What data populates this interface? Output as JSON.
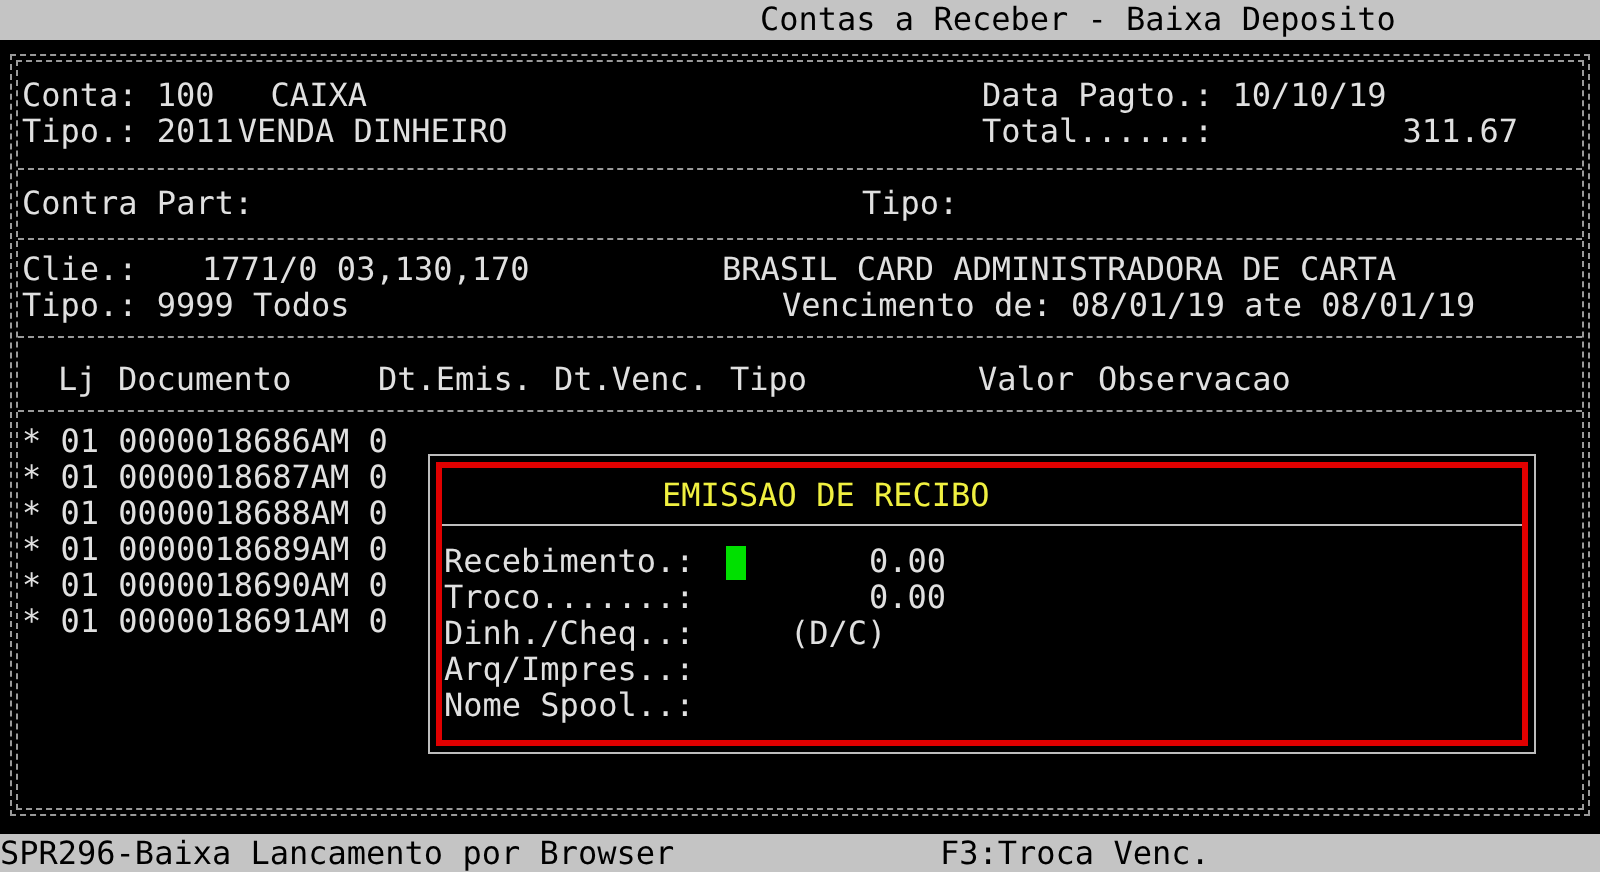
{
  "window": {
    "title": "Contas a Receber - Baixa Deposito"
  },
  "account": {
    "conta_label": "Conta:",
    "conta": "100",
    "conta_name": "CAIXA",
    "tipo_label": "Tipo.:",
    "tipo": "2011",
    "tipo_name": "VENDA DINHEIRO",
    "data_label": "Data Pagto.:",
    "data": "10/10/19",
    "total_label": "Total......:",
    "total": "311.67"
  },
  "counterpart": {
    "label": "Contra Part:",
    "tipo_label": "Tipo:"
  },
  "client": {
    "label": "Clie.:",
    "code": "1771/0 03,130,170",
    "name": "BRASIL CARD ADMINISTRADORA DE CARTA",
    "tipo_label": "Tipo.:",
    "tipo": "9999 Todos",
    "vencimento_label": "Vencimento de:",
    "from": "08/01/19",
    "ate": "ate",
    "to": "08/01/19"
  },
  "table": {
    "columns": [
      "Lj",
      "Documento",
      "Dt.Emis.",
      "Dt.Venc.",
      "Tipo",
      "Valor",
      "Observacao"
    ],
    "rows": [
      {
        "marker": "*",
        "lj": "01",
        "documento": "0000018686AM",
        "column_3": "0"
      },
      {
        "marker": "*",
        "lj": "01",
        "documento": "0000018687AM",
        "column_3": "0"
      },
      {
        "marker": "*",
        "lj": "01",
        "documento": "0000018688AM",
        "column_3": "0"
      },
      {
        "marker": "*",
        "lj": "01",
        "documento": "0000018689AM",
        "column_3": "0"
      },
      {
        "marker": "*",
        "lj": "01",
        "documento": "0000018690AM",
        "column_3": "0"
      },
      {
        "marker": "*",
        "lj": "01",
        "documento": "0000018691AM",
        "column_3": "0"
      }
    ]
  },
  "dialog": {
    "title": "EMISSAO DE RECIBO",
    "fields": [
      {
        "label": "Recebimento.:",
        "kind": "amount",
        "value": "0.00",
        "focused": true
      },
      {
        "label": "Troco.......:",
        "kind": "amount",
        "value": "0.00",
        "focused": false
      },
      {
        "label": "Dinh./Cheq..:",
        "kind": "option",
        "value": "(D/C)",
        "focused": false
      },
      {
        "label": "Arq/Impres..:",
        "kind": "text",
        "focused": false
      },
      {
        "label": "Nome Spool..:",
        "kind": "text",
        "focused": false
      }
    ]
  },
  "status_bar": {
    "program": "SPR296-Baixa Lancamento por Browser",
    "hint": "F3:Troca Venc."
  }
}
